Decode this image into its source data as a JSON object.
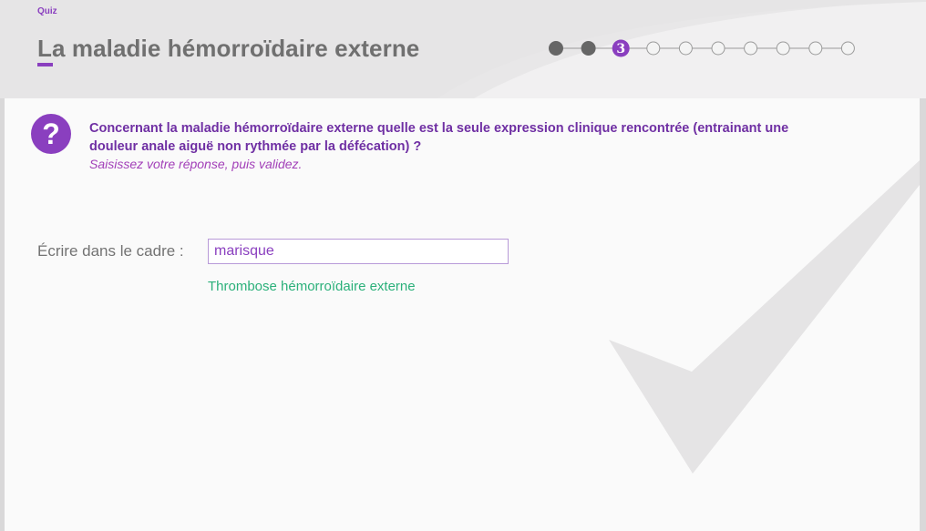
{
  "header": {
    "section": "Quiz",
    "title": "La maladie hémorroïdaire externe"
  },
  "progress": {
    "total": 10,
    "current": 3,
    "current_label": "3",
    "completed": 2
  },
  "question": {
    "icon": "question-mark-icon",
    "icon_glyph": "?",
    "text": "Concernant la maladie hémorroïdaire externe quelle est la seule expression clinique rencontrée (entrainant une douleur anale aiguë non rythmée par la défécation) ?",
    "instruction": "Saisissez votre réponse, puis validez."
  },
  "answer": {
    "label": "Écrire dans le cadre :",
    "value": "marisque",
    "correct": "Thrombose hémorroïdaire externe"
  },
  "colors": {
    "accent": "#8a3fbf",
    "correct": "#2bb07a",
    "title": "#707070"
  },
  "decor": {
    "watermark_icon": "checkmark-icon"
  }
}
